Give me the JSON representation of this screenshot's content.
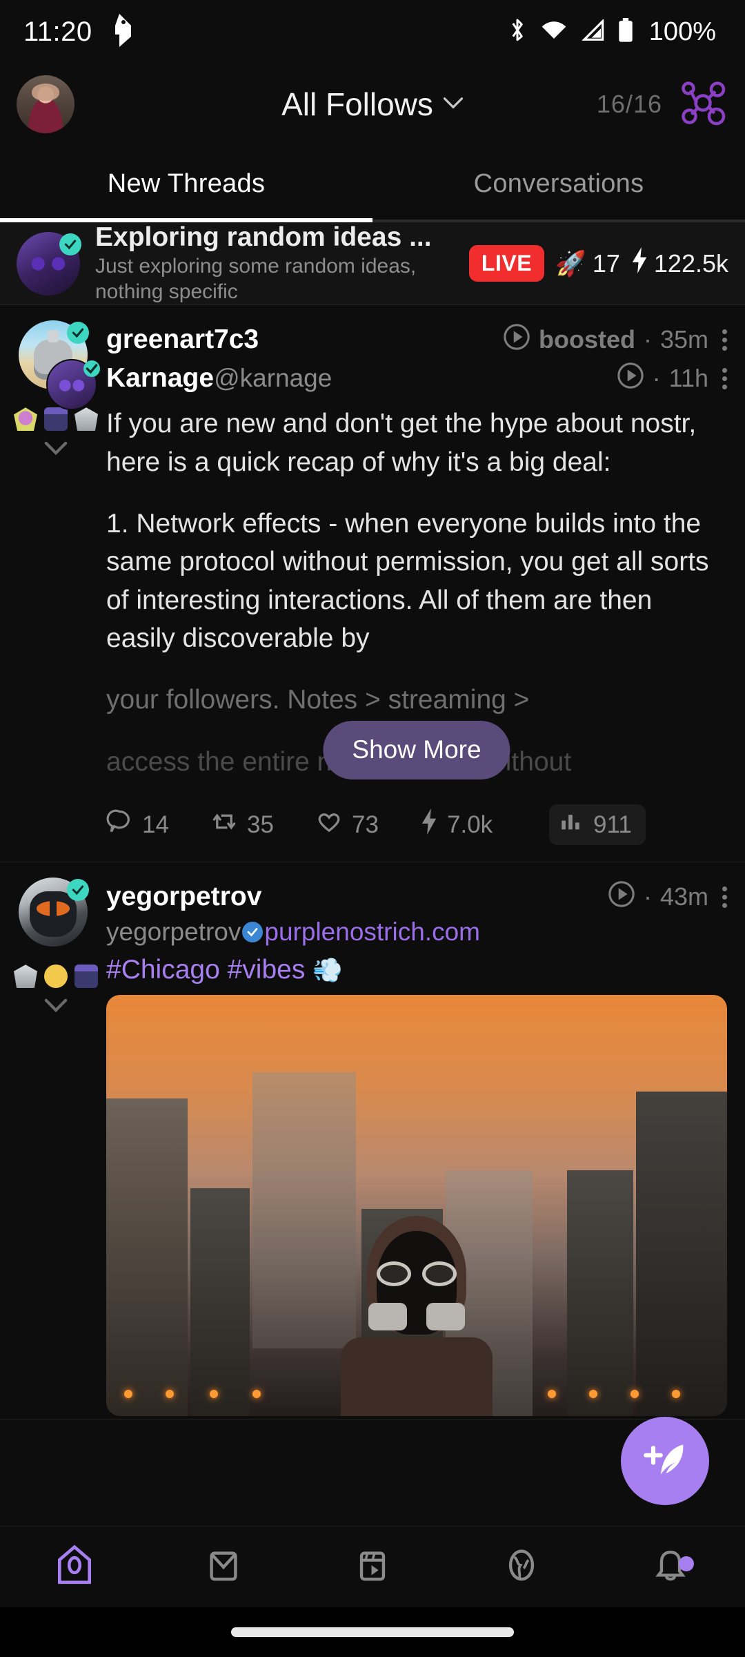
{
  "status_bar": {
    "time": "11:20",
    "app_logo_icon": "ostrich-logo-icon",
    "icons": [
      "bluetooth-icon",
      "wifi-icon",
      "cellular-signal-icon",
      "battery-icon"
    ],
    "battery_percent": "100%"
  },
  "header": {
    "avatar_name": "user-avatar",
    "title": "All Follows",
    "dropdown_icon": "chevron-down-icon",
    "relay_count": "16/16",
    "relay_icon": "relay-network-icon"
  },
  "tabs": [
    {
      "label": "New Threads",
      "active": true
    },
    {
      "label": "Conversations",
      "active": false
    }
  ],
  "live_banner": {
    "avatar_name": "live-stream-avatar",
    "verified": true,
    "title": "Exploring random ideas ...",
    "subtitle": "Just exploring some random ideas, nothing specific",
    "badge": "LIVE",
    "rocket_icon": "rocket-emoji",
    "participants": "17",
    "zap_icon": "lightning-icon",
    "zaps": "122.5k"
  },
  "posts": [
    {
      "booster_name": "greenart7c3",
      "boost_label": "boosted",
      "boost_time": "35m",
      "author_name": "Karnage",
      "author_handle": "@karnage",
      "author_time": "11h",
      "play_icon": "play-circle-icon",
      "menu_icon": "kebab-menu-icon",
      "expand_icon": "chevron-down-icon",
      "text_p1": "If you are new and don't get the hype about nostr, here is a quick recap of why it's a big deal:",
      "text_p2": "1. Network effects - when everyone builds into the same protocol without permission, you get all sorts of interesting interactions. All of them are then easily discoverable by",
      "text_faded_1": "your followers. Notes > streaming >",
      "text_faded_2": "access the entire nostr network without",
      "show_more": "Show More",
      "actions": {
        "reply_icon": "reply-bubble-icon",
        "reply_count": "14",
        "repost_icon": "repost-icon",
        "repost_count": "35",
        "like_icon": "heart-icon",
        "like_count": "73",
        "zap_icon": "lightning-icon",
        "zap_count": "7.0k",
        "stats_icon": "bar-chart-icon",
        "stats_count": "911"
      }
    },
    {
      "author_name": "yegorpetrov",
      "nip05_user": "yegorpetrov",
      "nip05_badge_icon": "verified-check-icon",
      "nip05_domain": "purplenostrich.com",
      "author_time": "43m",
      "play_icon": "play-circle-icon",
      "menu_icon": "kebab-menu-icon",
      "expand_icon": "chevron-down-icon",
      "tags": "#Chicago #vibes",
      "tag_emoji": "💨",
      "media_name": "post-image-dystopian-city"
    }
  ],
  "fab": {
    "icon": "compose-feather-icon",
    "label": "Compose note"
  },
  "bottom_nav": [
    {
      "icon": "home-birdhouse-icon",
      "active": true,
      "badge": false
    },
    {
      "icon": "messages-envelope-icon",
      "active": false,
      "badge": false
    },
    {
      "icon": "video-reels-icon",
      "active": false,
      "badge": false
    },
    {
      "icon": "discover-globe-icon",
      "active": false,
      "badge": false
    },
    {
      "icon": "notifications-bell-icon",
      "active": false,
      "badge": true
    }
  ],
  "colors": {
    "background": "#0d0d0d",
    "accent_purple": "#a87ff0",
    "relay_purple": "#8b3fc4",
    "live_red": "#f22d2d",
    "verified_teal": "#3dd6c0",
    "nip05_blue": "#3b87d6",
    "show_more_bg": "#5b4b7a"
  }
}
